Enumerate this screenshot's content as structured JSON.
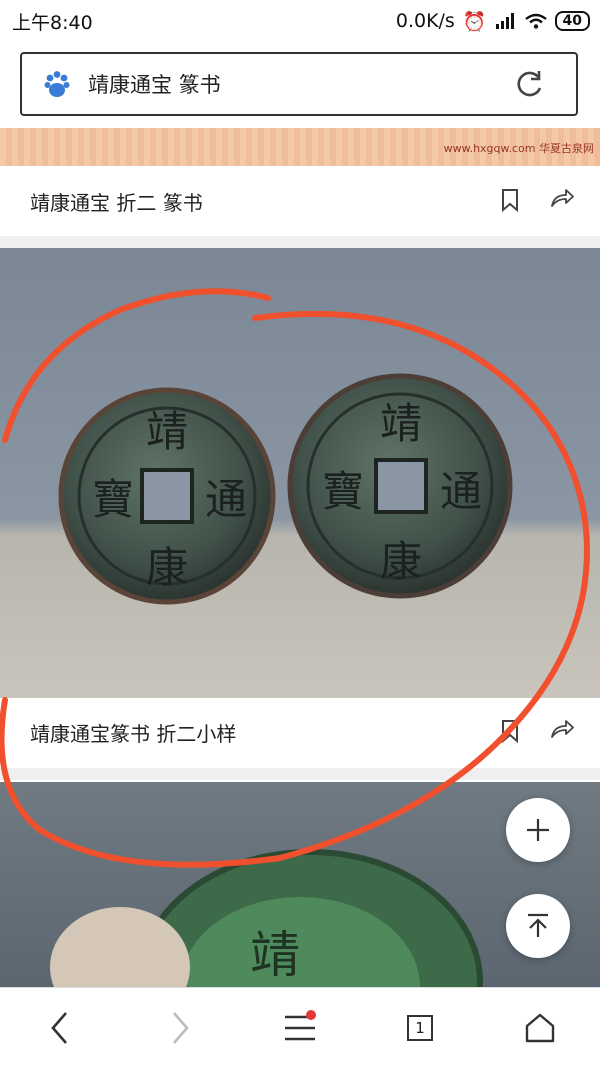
{
  "status": {
    "time": "上午8:40",
    "network_speed": "0.0K/s",
    "battery": "40"
  },
  "search": {
    "query": "靖康通宝 篆书"
  },
  "banner": {
    "site_text": "www.hxgqw.com 华夏古泉网"
  },
  "cards": [
    {
      "title": "靖康通宝 折二 篆书"
    },
    {
      "title": "靖康通宝篆书 折二小样"
    }
  ],
  "bottom_nav": {
    "tab_count": "1"
  },
  "colors": {
    "annotation": "#f0502e",
    "notification_dot": "#e53935"
  }
}
